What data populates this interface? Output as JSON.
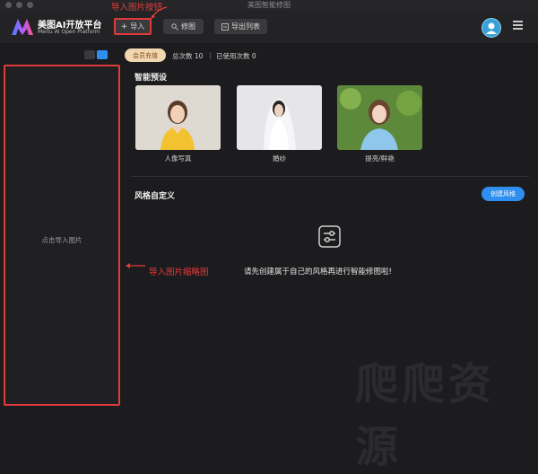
{
  "window": {
    "title": "美图智能修图"
  },
  "header": {
    "logo_title": "美图AI开放平台",
    "logo_subtitle": "Meitu AI Open Platform",
    "import_label": "导入",
    "retouch_label": "修图",
    "export_label": "导出列表"
  },
  "annotations": {
    "import_button": "导入图片按钮",
    "thumbnail": "导入图片缩略图"
  },
  "sidebar": {
    "placeholder": "点击导入图片"
  },
  "info": {
    "member_badge": "会员充值",
    "total_count": "总次数 10",
    "separator": "|",
    "used_count": "已使用次数 0"
  },
  "presets": {
    "title": "智能预设",
    "items": [
      {
        "label": "人像写真"
      },
      {
        "label": "婚纱"
      },
      {
        "label": "提亮/鲜艳"
      }
    ]
  },
  "custom_style": {
    "title": "风格自定义",
    "create_label": "创建风格",
    "empty_text": "请先创建属于自己的风格再进行智能修图啦!"
  },
  "watermark": {
    "text": "爬爬资源"
  },
  "colors": {
    "accent": "#2f8ff0",
    "annotation": "#e13a3a",
    "badge": "#f2d6b0",
    "background": "#1c1c1e"
  }
}
